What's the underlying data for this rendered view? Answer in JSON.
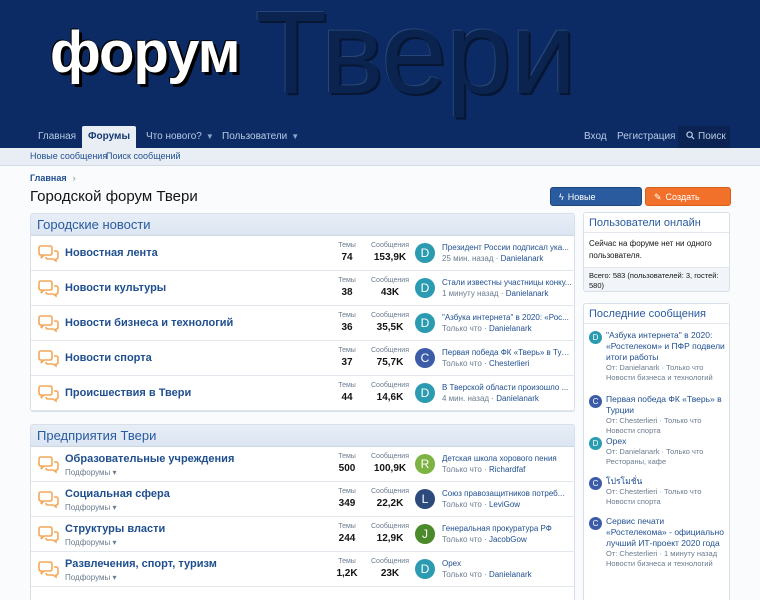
{
  "header": {
    "logo_small": "форум",
    "logo_big": "Твери"
  },
  "nav": {
    "home": "Главная",
    "forums": "Форумы",
    "whats_new": "Что нового?",
    "members": "Пользователи",
    "login": "Вход",
    "register": "Регистрация",
    "search": "Поиск"
  },
  "subnav": {
    "new_posts": "Новые сообщения",
    "search_posts": "Поиск сообщений"
  },
  "breadcrumb": {
    "home": "Главная"
  },
  "page_title": "Городской форум Твери",
  "buttons": {
    "new_posts": "Новые сообщения",
    "create_thread": "Создать тему..."
  },
  "stat_labels": {
    "threads": "Темы",
    "messages": "Сообщения"
  },
  "subforums_label": "Подфорумы",
  "category1": {
    "title": "Городские новости",
    "nodes": [
      {
        "title": "Новостная лента",
        "threads": "74",
        "messages": "153,9K",
        "avatar": "D",
        "avatar_color": "#2a9bb0",
        "last_title": "Президент России подписал ука...",
        "last_time": "25 мин. назад",
        "last_user": "Danielanark"
      },
      {
        "title": "Новости культуры",
        "threads": "38",
        "messages": "43K",
        "avatar": "D",
        "avatar_color": "#2a9bb0",
        "last_title": "Стали известны участницы конку...",
        "last_time": "1 минуту назад",
        "last_user": "Danielanark"
      },
      {
        "title": "Новости бизнеса и технологий",
        "threads": "36",
        "messages": "35,5K",
        "avatar": "D",
        "avatar_color": "#2a9bb0",
        "last_title": "\"Азбука интернета\" в 2020: «Рос...",
        "last_time": "Только что",
        "last_user": "Danielanark"
      },
      {
        "title": "Новости спорта",
        "threads": "37",
        "messages": "75,7K",
        "avatar": "C",
        "avatar_color": "#3d5ca8",
        "last_title": "Первая победа ФК «Тверь» в Тур...",
        "last_time": "Только что",
        "last_user": "Chesterlieri"
      },
      {
        "title": "Происшествия в Твери",
        "threads": "44",
        "messages": "14,6K",
        "avatar": "D",
        "avatar_color": "#2a9bb0",
        "last_title": "В Тверской области произошло ...",
        "last_time": "4 мин. назад",
        "last_user": "Danielanark"
      }
    ]
  },
  "category2": {
    "title": "Предприятия Твери",
    "nodes": [
      {
        "title": "Образовательные учреждения",
        "threads": "500",
        "messages": "100,9K",
        "avatar": "R",
        "avatar_color": "#7cb342",
        "last_title": "Детская школа хорового пения",
        "last_time": "Только что",
        "last_user": "Richardfaf"
      },
      {
        "title": "Социальная сфера",
        "threads": "349",
        "messages": "22,2K",
        "avatar": "L",
        "avatar_color": "#2c4a7c",
        "last_title": "Союз правозащитников потреб...",
        "last_time": "Только что",
        "last_user": "LeviGow"
      },
      {
        "title": "Структуры власти",
        "threads": "244",
        "messages": "12,9K",
        "avatar": "J",
        "avatar_color": "#4a8a2a",
        "last_title": "Генеральная прокуратура РФ",
        "last_time": "Только что",
        "last_user": "JacobGow"
      },
      {
        "title": "Развлечения, спорт, туризм",
        "threads": "1,2K",
        "messages": "23K",
        "avatar": "D",
        "avatar_color": "#2a9bb0",
        "last_title": "Opex",
        "last_time": "Только что",
        "last_user": "Danielanark"
      }
    ]
  },
  "online": {
    "title": "Пользователи онлайн",
    "body": "Сейчас на форуме нет ни одного пользователя.",
    "foot": "Всего: 583 (пользователей: 3, гостей: 580)"
  },
  "recent": {
    "title": "Последние сообщения",
    "items": [
      {
        "avatar": "D",
        "color": "#2a9bb0",
        "title": "\"Азбука интернета\" в 2020: «Ростелеком» и ПФР подвели итоги работы",
        "meta1": "От: Danielanark · Только что",
        "meta2": "Новости бизнеса и технологий"
      },
      {
        "avatar": "C",
        "color": "#3d5ca8",
        "title": "Первая победа ФК «Тверь» в Турции",
        "meta1": "От: Chesterlieri · Только что",
        "meta2": "Новости спорта"
      },
      {
        "avatar": "D",
        "color": "#2a9bb0",
        "title": "Opex",
        "meta1": "От: Danielanark · Только что",
        "meta2": "Рестораны, кафе"
      },
      {
        "avatar": "C",
        "color": "#3d5ca8",
        "title": "โปรโมชั่น",
        "meta1": "От: Chesterlieri · Только что",
        "meta2": "Новости спорта"
      },
      {
        "avatar": "C",
        "color": "#3d5ca8",
        "title": "Сервис печати «Ростелекома» - официально лучший ИТ-проект 2020 года",
        "meta1": "От: Chesterlieri · 1 минуту назад",
        "meta2": "Новости бизнеса и технологий"
      }
    ]
  }
}
